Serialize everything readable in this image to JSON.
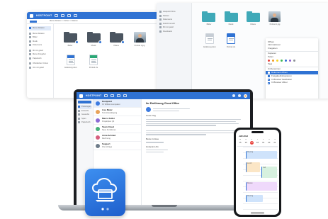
{
  "file_window": {
    "brand": "HOSTPOINT",
    "breadcrumb": "Meine Dateien  >  Ordner  >  Dateien",
    "sidebar": [
      "Meine Dateien",
      "Meine Dateien",
      "Bilder",
      "Musik",
      "Dokumente",
      "Mit mir geteilt",
      "Meine Freigaben",
      "Papierkorb",
      "Öffentlicher Ordner",
      "Von mir geteilt"
    ],
    "items_row1": [
      "Bilder",
      "Musik",
      "Videos",
      "Portrait 1.jpg"
    ],
    "items_row2": [
      "Einleitung.docx",
      "Portrait.xls"
    ]
  },
  "right_panel": {
    "sidebar": [
      "Hostpoint Drive",
      "Dateien",
      "Dokumente",
      "Zuletzt benutzt",
      "Mit mir geteilt",
      "Downloads"
    ],
    "folders": [
      "Bilder",
      "Musik",
      "Videos",
      "Portrait 1.jpg"
    ],
    "docs": [
      "Einleitung.docx",
      "Portrait.xls"
    ],
    "context_menu": {
      "items_top": [
        "Öffnen",
        "Informationen",
        "Freigeben"
      ],
      "items_mid": [
        "Kopieren",
        "Teilen"
      ],
      "tags_label": "Tags",
      "tag_colors": [
        "#e8413b",
        "#f39c21",
        "#f5d327",
        "#3fb950",
        "#2f72d3",
        "#8e5fd1",
        "#8a8f96"
      ],
      "section_label": "Umbenennen",
      "check_items": [
        {
          "label": "Dokument öffnen",
          "checked": true,
          "selected": true
        },
        {
          "label": "Freigabelink kopieren",
          "checked": true,
          "selected": false
        },
        {
          "label": "In Browser bearbeiten",
          "checked": false,
          "selected": false
        },
        {
          "label": "In Browser öffnen",
          "checked": false,
          "selected": false
        }
      ]
    }
  },
  "laptop": {
    "brand": "HOSTPOINT",
    "mail_folders": [
      "Posteingang",
      "Entwürfe",
      "Gesendet",
      "Spam",
      "Papierkorb"
    ],
    "mail_items": [
      {
        "from": "Hostpoint",
        "subject": "Ihr Willkommenspaket",
        "color": "#3d7be0"
      },
      {
        "from": "Lisa Meier",
        "subject": "Terminbestätigung",
        "color": "#e8a35a"
      },
      {
        "from": "Marco Keller",
        "subject": "Projektplan Q3",
        "color": "#8c6bd6"
      },
      {
        "from": "Team Cloud",
        "subject": "Neue Funktionen",
        "color": "#46b07a"
      },
      {
        "from": "Anna Schmid",
        "subject": "Rechnung",
        "color": "#d65f7f"
      },
      {
        "from": "Support",
        "subject": "Ihre Anfrage",
        "color": "#6e7c8a"
      }
    ],
    "message": {
      "subject": "Ihr Einführung Cloud Office",
      "greeting": "Guten Tag",
      "sign_off": "Beste Grüsse",
      "sender": "Hostpoint AG"
    }
  },
  "phone": {
    "month": "Juli 2024",
    "weekdays": [
      "M",
      "D",
      "M",
      "D",
      "F",
      "S",
      "S"
    ],
    "days": [
      "15",
      "16",
      "17",
      "18",
      "19",
      "20",
      "21"
    ],
    "today_index": 2,
    "events": [
      {
        "label": "Meeting",
        "color": "#cfe3fb"
      },
      {
        "label": "Lunch",
        "color": "#fbe6c6"
      },
      {
        "label": "Call",
        "color": "#d7f1df"
      },
      {
        "label": "Review",
        "color": "#efd9fb"
      }
    ]
  },
  "cloud_badge": {
    "icon": "cloud-laptop-icon",
    "dots": 2
  },
  "colors": {
    "accent": "#2f72d3",
    "device_dark": "#1b1d21"
  }
}
